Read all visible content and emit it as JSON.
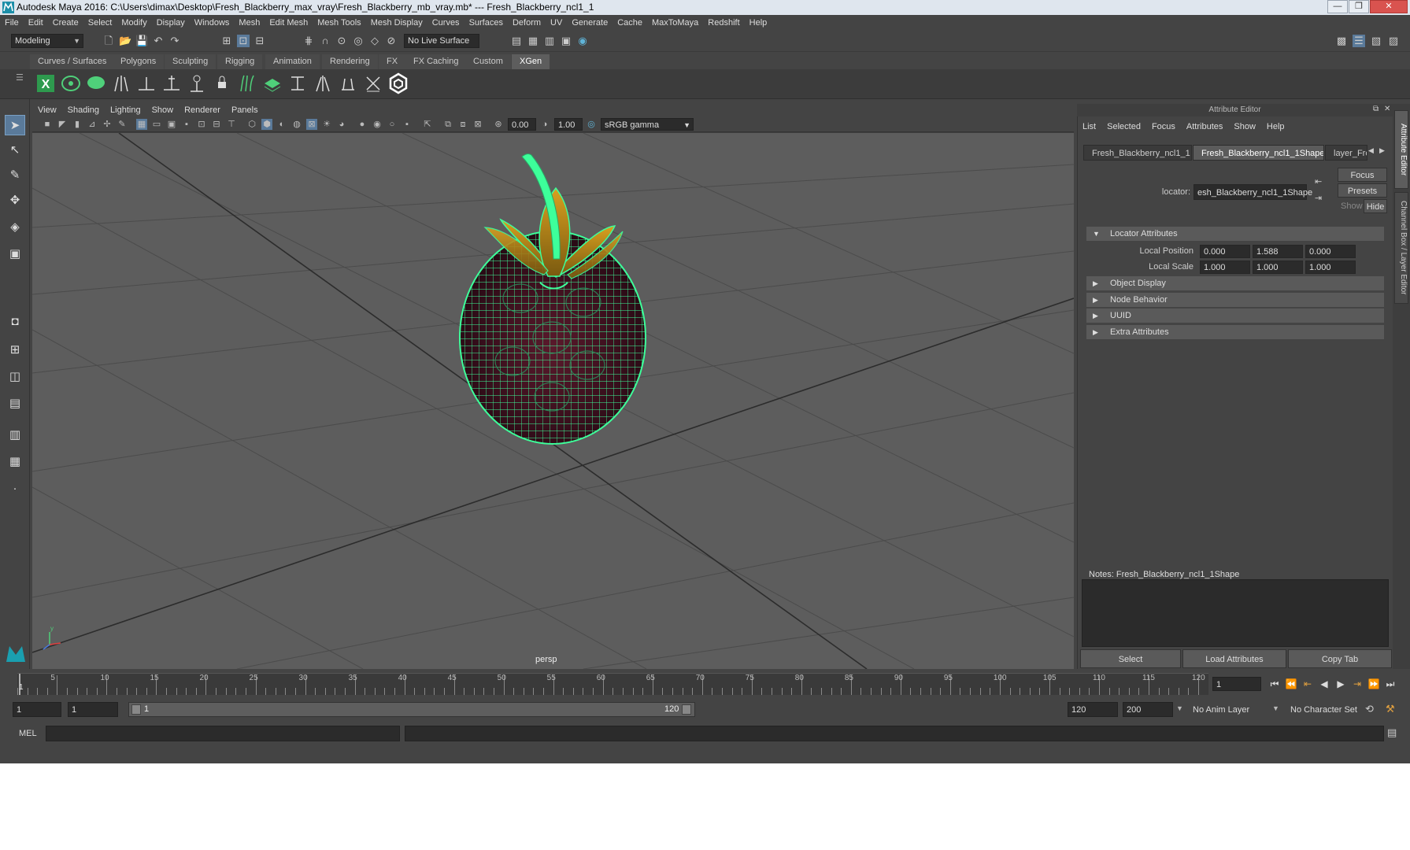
{
  "window": {
    "title": "Autodesk Maya 2016: C:\\Users\\dimax\\Desktop\\Fresh_Blackberry_max_vray\\Fresh_Blackberry_mb_vray.mb*   ---   Fresh_Blackberry_ncl1_1",
    "min": "—",
    "max": "❐",
    "close": "✕"
  },
  "menubar": [
    "File",
    "Edit",
    "Create",
    "Select",
    "Modify",
    "Display",
    "Windows",
    "Mesh",
    "Edit Mesh",
    "Mesh Tools",
    "Mesh Display",
    "Curves",
    "Surfaces",
    "Deform",
    "UV",
    "Generate",
    "Cache",
    "MaxToMaya",
    "Redshift",
    "Help"
  ],
  "statusline": {
    "mode": "Modeling",
    "live_surface": "No Live Surface"
  },
  "shelf_tabs": [
    "Curves / Surfaces",
    "Polygons",
    "Sculpting",
    "Rigging",
    "Animation",
    "Rendering",
    "FX",
    "FX Caching",
    "Custom",
    "XGen"
  ],
  "shelf_active": "XGen",
  "viewport": {
    "menu": [
      "View",
      "Shading",
      "Lighting",
      "Show",
      "Renderer",
      "Panels"
    ],
    "exposure": "0.00",
    "gamma": "1.00",
    "colorspace": "sRGB gamma",
    "camera": "persp"
  },
  "attribute_editor": {
    "title": "Attribute Editor",
    "menu": [
      "List",
      "Selected",
      "Focus",
      "Attributes",
      "Show",
      "Help"
    ],
    "tabs": [
      "Fresh_Blackberry_ncl1_1",
      "Fresh_Blackberry_ncl1_1Shape",
      "layer_Fre"
    ],
    "active_tab": "Fresh_Blackberry_ncl1_1Shape",
    "locator_label": "locator:",
    "locator_value": "esh_Blackberry_ncl1_1Shape",
    "focus": "Focus",
    "presets": "Presets",
    "show": "Show",
    "hide": "Hide",
    "sections": [
      "Locator Attributes",
      "Object Display",
      "Node Behavior",
      "UUID",
      "Extra Attributes"
    ],
    "local_position_label": "Local Position",
    "local_position": [
      "0.000",
      "1.588",
      "0.000"
    ],
    "local_scale_label": "Local Scale",
    "local_scale": [
      "1.000",
      "1.000",
      "1.000"
    ],
    "notes_label": "Notes:  Fresh_Blackberry_ncl1_1Shape",
    "buttons": [
      "Select",
      "Load Attributes",
      "Copy Tab"
    ]
  },
  "side_tabs": [
    "Attribute Editor",
    "Channel Box / Layer Editor"
  ],
  "timeline": {
    "ticks": [
      "1",
      "5",
      "10",
      "15",
      "20",
      "25",
      "30",
      "35",
      "40",
      "45",
      "50",
      "55",
      "60",
      "65",
      "70",
      "75",
      "80",
      "85",
      "90",
      "95",
      "100",
      "105",
      "110",
      "115",
      "120"
    ],
    "current_frame": "1"
  },
  "range": {
    "start": "1",
    "playback_start": "1",
    "slider_start": "1",
    "slider_end": "120",
    "playback_end": "120",
    "end": "200",
    "anim_layer": "No Anim Layer",
    "character_set": "No Character Set"
  },
  "command_line": {
    "label": "MEL"
  },
  "colors": {
    "wireframe": "#3dff9a",
    "berry": "#3a0f1c",
    "leaf": "#b88a1c",
    "accent": "#5a7a9a"
  }
}
